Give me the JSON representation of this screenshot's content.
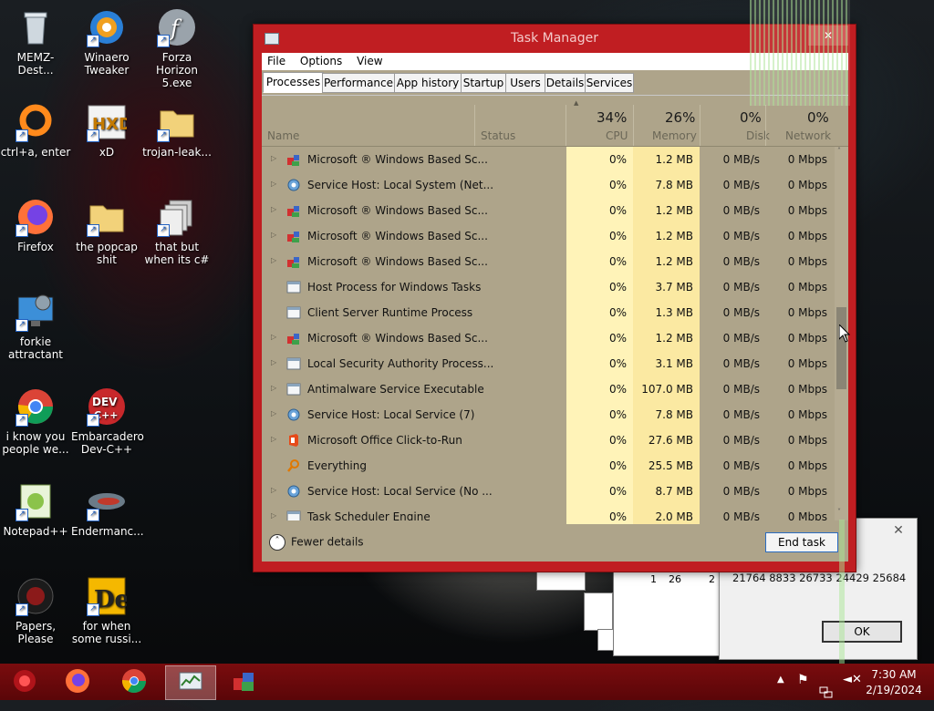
{
  "desktop": {
    "icons": [
      {
        "label": "MEMZ-Dest...",
        "icon": "recycle-bin-icon"
      },
      {
        "label": "Winaero Tweaker",
        "icon": "winaero-icon"
      },
      {
        "label": "Forza Horizon 5.exe",
        "icon": "flash-icon"
      },
      {
        "label": "ctrl+a, enter",
        "icon": "orange-ring-icon"
      },
      {
        "label": "xD",
        "icon": "hxd-icon"
      },
      {
        "label": "trojan-leak...",
        "icon": "folder-icon"
      },
      {
        "label": "Firefox",
        "icon": "firefox-icon"
      },
      {
        "label": "the popcap shit",
        "icon": "folder-icon"
      },
      {
        "label": "that but when its c#",
        "icon": "documents-icon"
      },
      {
        "label": "forkie attractant",
        "icon": "monitor-gear-icon"
      },
      {
        "label": "i know you people we...",
        "icon": "chrome-icon"
      },
      {
        "label": "Embarcadero Dev-C++",
        "icon": "devcpp-icon"
      },
      {
        "label": "Notepad++",
        "icon": "notepadpp-icon"
      },
      {
        "label": "Endermanc...",
        "icon": "fish-icon"
      },
      {
        "label": "Papers, Please",
        "icon": "papers-please-icon"
      },
      {
        "label": "for when some russi...",
        "icon": "delphi-icon"
      }
    ]
  },
  "popup": {
    "numbers": "21764 8833 26733 24429 25684",
    "partial": [
      "1",
      "26",
      "2"
    ],
    "ok_label": "OK",
    "close_glyph": "✕"
  },
  "task_manager": {
    "title": "Task Manager",
    "close_glyph": "✕",
    "menu": [
      "File",
      "Options",
      "View"
    ],
    "tabs": [
      "Processes",
      "Performance",
      "App history",
      "Startup",
      "Users",
      "Details",
      "Services"
    ],
    "active_tab": "Processes",
    "columns": {
      "name": "Name",
      "status": "Status",
      "cpu": {
        "pct": "34%",
        "label": "CPU"
      },
      "memory": {
        "pct": "26%",
        "label": "Memory"
      },
      "disk": {
        "pct": "0%",
        "label": "Disk"
      },
      "network": {
        "pct": "0%",
        "label": "Network"
      }
    },
    "rows": [
      {
        "name": "Microsoft ® Windows Based Sc...",
        "cpu": "0%",
        "mem": "1.2 MB",
        "disk": "0 MB/s",
        "net": "0 Mbps",
        "expand": true,
        "icon": "csrss-icon"
      },
      {
        "name": "Service Host: Local System (Net...",
        "cpu": "0%",
        "mem": "7.8 MB",
        "disk": "0 MB/s",
        "net": "0 Mbps",
        "expand": true,
        "icon": "gear-icon"
      },
      {
        "name": "Microsoft ® Windows Based Sc...",
        "cpu": "0%",
        "mem": "1.2 MB",
        "disk": "0 MB/s",
        "net": "0 Mbps",
        "expand": true,
        "icon": "csrss-icon"
      },
      {
        "name": "Microsoft ® Windows Based Sc...",
        "cpu": "0%",
        "mem": "1.2 MB",
        "disk": "0 MB/s",
        "net": "0 Mbps",
        "expand": true,
        "icon": "csrss-icon"
      },
      {
        "name": "Microsoft ® Windows Based Sc...",
        "cpu": "0%",
        "mem": "1.2 MB",
        "disk": "0 MB/s",
        "net": "0 Mbps",
        "expand": true,
        "icon": "csrss-icon"
      },
      {
        "name": "Host Process for Windows Tasks",
        "cpu": "0%",
        "mem": "3.7 MB",
        "disk": "0 MB/s",
        "net": "0 Mbps",
        "expand": false,
        "icon": "window-icon"
      },
      {
        "name": "Client Server Runtime Process",
        "cpu": "0%",
        "mem": "1.3 MB",
        "disk": "0 MB/s",
        "net": "0 Mbps",
        "expand": false,
        "icon": "window-icon"
      },
      {
        "name": "Microsoft ® Windows Based Sc...",
        "cpu": "0%",
        "mem": "1.2 MB",
        "disk": "0 MB/s",
        "net": "0 Mbps",
        "expand": true,
        "icon": "csrss-icon"
      },
      {
        "name": "Local Security Authority Process...",
        "cpu": "0%",
        "mem": "3.1 MB",
        "disk": "0 MB/s",
        "net": "0 Mbps",
        "expand": true,
        "icon": "window-icon"
      },
      {
        "name": "Antimalware Service Executable",
        "cpu": "0%",
        "mem": "107.0 MB",
        "disk": "0 MB/s",
        "net": "0 Mbps",
        "expand": true,
        "icon": "window-icon"
      },
      {
        "name": "Service Host: Local Service (7)",
        "cpu": "0%",
        "mem": "7.8 MB",
        "disk": "0 MB/s",
        "net": "0 Mbps",
        "expand": true,
        "icon": "gear-icon"
      },
      {
        "name": "Microsoft Office Click-to-Run",
        "cpu": "0%",
        "mem": "27.6 MB",
        "disk": "0 MB/s",
        "net": "0 Mbps",
        "expand": true,
        "icon": "office-icon"
      },
      {
        "name": "Everything",
        "cpu": "0%",
        "mem": "25.5 MB",
        "disk": "0 MB/s",
        "net": "0 Mbps",
        "expand": false,
        "icon": "search-icon"
      },
      {
        "name": "Service Host: Local Service (No ...",
        "cpu": "0%",
        "mem": "8.7 MB",
        "disk": "0 MB/s",
        "net": "0 Mbps",
        "expand": true,
        "icon": "gear-icon"
      },
      {
        "name": "Task Scheduler Engine",
        "cpu": "0%",
        "mem": "2.0 MB",
        "disk": "0 MB/s",
        "net": "0 Mbps",
        "expand": true,
        "icon": "window-icon"
      }
    ],
    "fewer_details": "Fewer details",
    "end_task": "End task"
  },
  "taskbar": {
    "apps": [
      "start-orb-icon",
      "firefox-icon",
      "chrome-icon",
      "task-manager-icon",
      "blocks-app-icon"
    ],
    "active_index": 3,
    "time": "7:30 AM",
    "date": "2/19/2024"
  }
}
